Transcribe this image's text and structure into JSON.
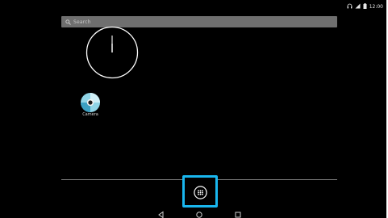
{
  "status_bar": {
    "icons": [
      "headset-icon",
      "wifi-icon",
      "battery-icon"
    ],
    "time": "12:00"
  },
  "search": {
    "placeholder": "Search"
  },
  "home": {
    "apps": [
      {
        "label": "Camera",
        "icon": "camera-icon"
      }
    ]
  },
  "dock": {
    "app_drawer_icon": "app-drawer-icon",
    "highlight_color": "#19b6ee"
  },
  "nav_bar": {
    "buttons": [
      "back-icon",
      "home-icon",
      "recents-icon"
    ]
  }
}
